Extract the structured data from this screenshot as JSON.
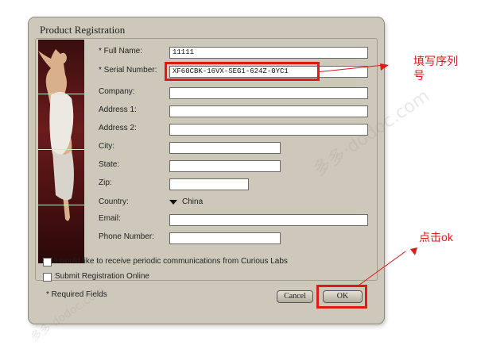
{
  "dialog": {
    "title": "Product Registration",
    "labels": {
      "full_name": "* Full Name:",
      "serial": "* Serial Number:",
      "company": "Company:",
      "address1": "Address 1:",
      "address2": "Address 2:",
      "city": "City:",
      "state": "State:",
      "zip": "Zip:",
      "country": "Country:",
      "email": "Email:",
      "phone": "Phone Number:"
    },
    "values": {
      "full_name": "11111",
      "serial": "XF60CBK-16VX-SEG1-624Z-0YC1",
      "company": "",
      "address1": "",
      "address2": "",
      "city": "",
      "state": "",
      "zip": "",
      "country": "China",
      "email": "",
      "phone": ""
    },
    "checks": {
      "communications": "I would like to receive periodic communications from Curious Labs",
      "online": "Submit Registration Online"
    },
    "required_note": "* Required Fields",
    "cancel_label": "Cancel",
    "ok_label": "OK"
  },
  "annotations": {
    "serial_note_1": "填写序列",
    "serial_note_2": "号",
    "ok_note": "点击ok",
    "color": "#e01818"
  },
  "watermark": "多多·dodoc.com"
}
